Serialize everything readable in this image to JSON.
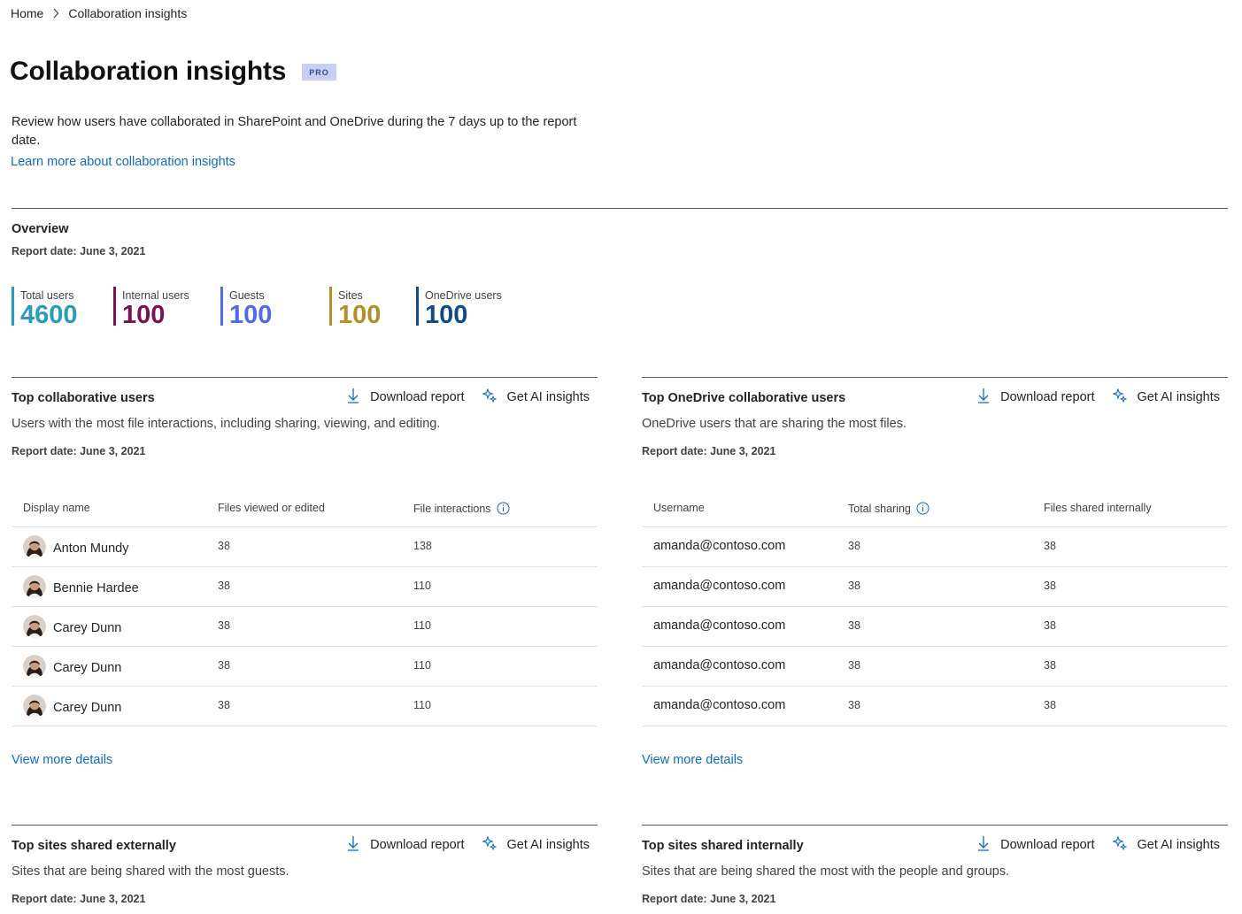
{
  "breadcrumb": {
    "home": "Home",
    "current": "Collaboration insights"
  },
  "page": {
    "title": "Collaboration insights",
    "badge": "PRO",
    "description": "Review how users have collaborated in SharePoint and OneDrive during the 7 days up to the report date.",
    "learn_more": "Learn more about collaboration insights"
  },
  "overview": {
    "title": "Overview",
    "report_date": "Report date: June 3, 2021",
    "metrics": [
      {
        "label": "Total users",
        "value": "4600",
        "color": "#2a9bbb"
      },
      {
        "label": "Internal users",
        "value": "100",
        "color": "#7a1451"
      },
      {
        "label": "Guests",
        "value": "100",
        "color": "#4f6bed"
      },
      {
        "label": "Sites",
        "value": "100",
        "color": "#b38f27"
      },
      {
        "label": "OneDrive users",
        "value": "100",
        "color": "#0f4a8a"
      }
    ]
  },
  "actions": {
    "download": "Download report",
    "ai": "Get AI insights"
  },
  "cards": {
    "collab": {
      "title": "Top collaborative users",
      "subtitle": "Users with the most file interactions, including sharing, viewing, and editing.",
      "report_date": "Report date: June 3, 2021",
      "columns": [
        "Display name",
        "Files viewed or edited",
        "File interactions"
      ],
      "rows": [
        [
          "Anton Mundy",
          "38",
          "138"
        ],
        [
          "Bennie Hardee",
          "38",
          "110"
        ],
        [
          "Carey Dunn",
          "38",
          "110"
        ],
        [
          "Carey Dunn",
          "38",
          "110"
        ],
        [
          "Carey Dunn",
          "38",
          "110"
        ]
      ],
      "view_more": "View more details"
    },
    "onedrive": {
      "title": "Top OneDrive collaborative users",
      "subtitle": "OneDrive users that are sharing the most files.",
      "report_date": "Report date: June 3, 2021",
      "columns": [
        "Username",
        "Total sharing",
        "Files shared internally"
      ],
      "rows": [
        [
          "amanda@contoso.com",
          "38",
          "38"
        ],
        [
          "amanda@contoso.com",
          "38",
          "38"
        ],
        [
          "amanda@contoso.com",
          "38",
          "38"
        ],
        [
          "amanda@contoso.com",
          "38",
          "38"
        ],
        [
          "amanda@contoso.com",
          "38",
          "38"
        ]
      ],
      "view_more": "View more details"
    },
    "external": {
      "title": "Top sites shared externally",
      "subtitle": "Sites that are being shared with the most guests.",
      "report_date": "Report date: June 3, 2021"
    },
    "internal": {
      "title": "Top sites shared internally",
      "subtitle": "Sites that are being shared the most with the people and groups.",
      "report_date": "Report date: June 3, 2021"
    }
  }
}
